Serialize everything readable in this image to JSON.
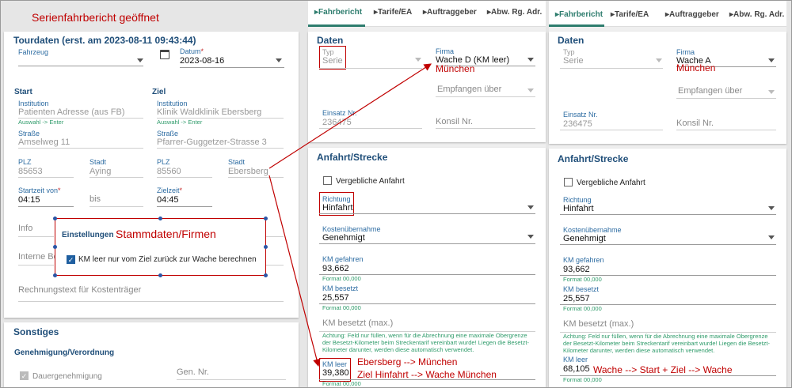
{
  "annotation_title": "Serienfahrbericht geöffnet",
  "left": {
    "tourdaten_title": "Tourdaten (erst. am 2023-08-11 09:43:44)",
    "fahrzeug_label": "Fahrzeug",
    "datum_label": "Datum",
    "datum_value": "2023-08-16",
    "start_heading": "Start",
    "ziel_heading": "Ziel",
    "institution_label": "Institution",
    "start_institution_value": "Patienten Adresse (aus FB)",
    "ziel_institution_value": "Klinik Waldklinik Ebersberg",
    "auswahl_hint": "Auswahl -> Enter",
    "strasse_label": "Straße",
    "start_strasse_value": "Amselweg 11",
    "ziel_strasse_value": "Pfarrer-Guggetzer-Strasse 3",
    "plz_label": "PLZ",
    "stadt_label": "Stadt",
    "start_plz_value": "85653",
    "start_stadt_value": "Aying",
    "ziel_plz_value": "85560",
    "ziel_stadt_value": "Ebersberg",
    "startzeit_label": "Startzeit von",
    "startzeit_value": "04:15",
    "bis_placeholder": "bis",
    "zielzeit_label": "Zielzeit",
    "zielzeit_value": "04:45",
    "info_placeholder": "Info",
    "interne_placeholder": "Interne Be",
    "rechnungstext_placeholder": "Rechnungstext für Kostenträger",
    "sonstiges_title": "Sonstiges",
    "genehmigung_heading": "Genehmigung/Verordnung",
    "dauergenehmigung_label": "Dauergenehmigung",
    "gen_nr_placeholder": "Gen. Nr."
  },
  "popup": {
    "title": "Einstellungen",
    "annotation": "Stammdaten/Firmen",
    "checkbox_label": "KM leer nur vom Ziel zurück zur Wache berechnen"
  },
  "tabs": [
    "Fahrbericht",
    "Tarife/EA",
    "Auftraggeber",
    "Abw. Rg. Adr."
  ],
  "middle": {
    "daten_title": "Daten",
    "typ_label": "Typ",
    "typ_value": "Serie",
    "firma_label": "Firma",
    "firma_value": "Wache D (KM leer)",
    "firma_annotation": "München",
    "empfangen_placeholder": "Empfangen über",
    "einsatz_label": "Einsatz Nr.",
    "einsatz_value": "236475",
    "konsil_placeholder": "Konsil Nr.",
    "anfahrt_title": "Anfahrt/Strecke",
    "vergebliche_label": "Vergebliche Anfahrt",
    "richtung_label": "Richtung",
    "richtung_value": "Hinfahrt",
    "kosten_label": "Kostenübernahme",
    "kosten_value": "Genehmigt",
    "km_gefahren_label": "KM gefahren",
    "km_gefahren_value": "93,662",
    "format_hint": "Format 00,000",
    "km_besetzt_label": "KM besetzt",
    "km_besetzt_value": "25,557",
    "km_besetzt_max_placeholder": "KM besetzt (max.)",
    "achtung_note": "Achtung: Feld nur füllen, wenn für die Abrechnung eine maximale Obergrenze der Besetzt-Kilometer beim Streckentarif vereinbart wurde! Liegen die Besetzt-Kilometer darunter, werden diese automatisch verwendet.",
    "km_leer_label": "KM leer",
    "km_leer_value": "39,380",
    "annotation_line1": "Ebersberg --> München",
    "annotation_line2": "Ziel Hinfahrt --> Wache München"
  },
  "right": {
    "daten_title": "Daten",
    "typ_label": "Typ",
    "typ_value": "Serie",
    "firma_label": "Firma",
    "firma_value": "Wache A",
    "firma_annotation": "München",
    "empfangen_placeholder": "Empfangen über",
    "einsatz_label": "Einsatz Nr.",
    "einsatz_value": "236475",
    "konsil_placeholder": "Konsil Nr.",
    "anfahrt_title": "Anfahrt/Strecke",
    "vergebliche_label": "Vergebliche Anfahrt",
    "richtung_label": "Richtung",
    "richtung_value": "Hinfahrt",
    "kosten_label": "Kostenübernahme",
    "kosten_value": "Genehmigt",
    "km_gefahren_label": "KM gefahren",
    "km_gefahren_value": "93,662",
    "format_hint": "Format 00,000",
    "km_besetzt_label": "KM besetzt",
    "km_besetzt_value": "25,557",
    "km_besetzt_max_placeholder": "KM besetzt (max.)",
    "achtung_note": "Achtung: Feld nur füllen, wenn für die Abrechnung eine maximale Obergrenze der Besetzt-Kilometer beim Streckentarif vereinbart wurde! Liegen die Besetzt-Kilometer darunter, werden diese automatisch verwendet.",
    "km_leer_label": "KM leer",
    "km_leer_value": "68,105",
    "annotation": "Wache --> Start + Ziel --> Wache"
  },
  "colors": {
    "annotation_red": "#c00000",
    "title_blue": "#1f4e79",
    "label_blue": "#2d6ca2",
    "hint_green": "#2e9b6a",
    "tab_active": "#2e7d6e"
  }
}
